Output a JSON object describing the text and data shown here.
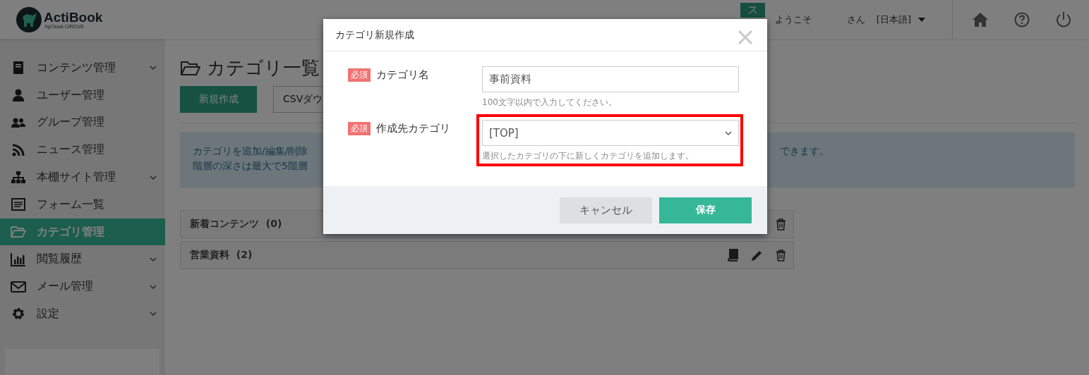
{
  "header": {
    "logo": "ActiBook",
    "logo_sub": "byCloud CIRCUS",
    "avatar": "ス",
    "welcome": "ようこそ",
    "honorific": "さん",
    "language": "[日本語]"
  },
  "sidebar": {
    "items": [
      {
        "label": "コンテンツ管理",
        "has_submenu": true,
        "selected": false
      },
      {
        "label": "ユーザー管理",
        "has_submenu": false,
        "selected": false
      },
      {
        "label": "グループ管理",
        "has_submenu": false,
        "selected": false
      },
      {
        "label": "ニュース管理",
        "has_submenu": false,
        "selected": false
      },
      {
        "label": "本棚サイト管理",
        "has_submenu": true,
        "selected": false
      },
      {
        "label": "フォーム一覧",
        "has_submenu": false,
        "selected": false
      },
      {
        "label": "カテゴリ管理",
        "has_submenu": false,
        "selected": true
      },
      {
        "label": "閲覧履歴",
        "has_submenu": true,
        "selected": false
      },
      {
        "label": "メール管理",
        "has_submenu": true,
        "selected": false
      },
      {
        "label": "設定",
        "has_submenu": true,
        "selected": false
      }
    ]
  },
  "page": {
    "title": "カテゴリ一覧",
    "buttons": [
      "新規作成",
      "CSVダウ"
    ],
    "info": [
      {
        "left": "カテゴリを追加/編集/削除",
        "right": "できます。"
      },
      {
        "left": "階層の深さは最大で5階層"
      }
    ],
    "categories": [
      {
        "name": "新着コンテンツ",
        "count": "(0)"
      },
      {
        "name": "営業資料",
        "count": "(2)",
        "show_book": true,
        "show_edit": true
      }
    ]
  },
  "dialog": {
    "title": "カテゴリ新規作成",
    "fields": [
      {
        "kind": "text",
        "required": "必須",
        "label": "カテゴリ名",
        "value": "事前資料",
        "hint": "100文字以内で入力してください。",
        "highlighted": false
      },
      {
        "kind": "select",
        "required": "必須",
        "label": "作成先カテゴリ",
        "value": "[TOP]",
        "hint": "選択したカテゴリの下に新しくカテゴリを追加します。",
        "highlighted": true
      }
    ],
    "cancel": "キャンセル",
    "save": "保存"
  }
}
